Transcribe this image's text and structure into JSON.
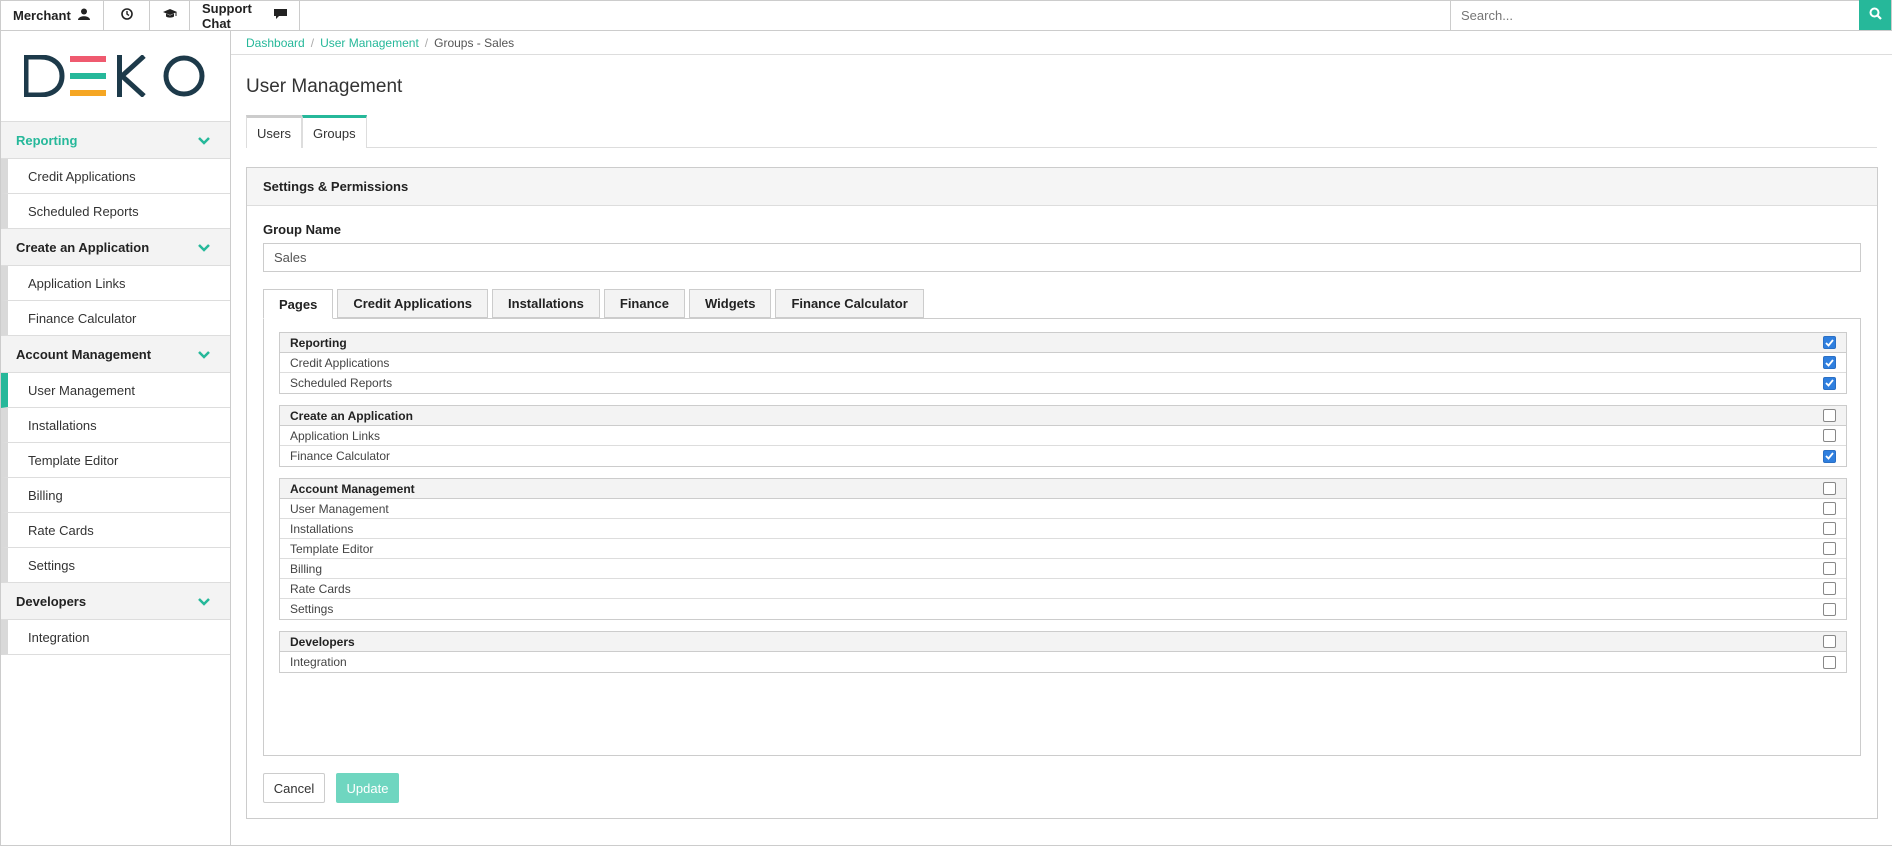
{
  "topbar": {
    "merchant_label": "Merchant",
    "support_label": "Support Chat",
    "search_placeholder": "Search...",
    "icons": [
      "user-icon",
      "clock-icon",
      "graduation-cap-icon",
      "chat-icon",
      "search-icon"
    ]
  },
  "logo": {
    "text": "DEKO"
  },
  "sidebar": {
    "sections": [
      {
        "label": "Reporting",
        "items": [
          "Credit Applications",
          "Scheduled Reports"
        ]
      },
      {
        "label": "Create an Application",
        "items": [
          "Application Links",
          "Finance Calculator"
        ]
      },
      {
        "label": "Account Management",
        "items": [
          "User Management",
          "Installations",
          "Template Editor",
          "Billing",
          "Rate Cards",
          "Settings"
        ]
      },
      {
        "label": "Developers",
        "items": [
          "Integration"
        ]
      }
    ]
  },
  "breadcrumb": {
    "dashboard": "Dashboard",
    "user_management": "User Management",
    "current": "Groups - Sales",
    "sep": "/"
  },
  "page_title": "User Management",
  "main_tabs": {
    "users": "Users",
    "groups": "Groups"
  },
  "panel": {
    "title": "Settings & Permissions",
    "group_name_label": "Group Name",
    "group_name_value": "Sales",
    "tabs": [
      "Pages",
      "Credit Applications",
      "Installations",
      "Finance",
      "Widgets",
      "Finance Calculator"
    ],
    "groups": [
      {
        "label": "Reporting",
        "checked": true,
        "items": [
          {
            "label": "Credit Applications",
            "checked": true
          },
          {
            "label": "Scheduled Reports",
            "checked": true
          }
        ]
      },
      {
        "label": "Create an Application",
        "checked": false,
        "items": [
          {
            "label": "Application Links",
            "checked": false
          },
          {
            "label": "Finance Calculator",
            "checked": true
          }
        ]
      },
      {
        "label": "Account Management",
        "checked": false,
        "items": [
          {
            "label": "User Management",
            "checked": false
          },
          {
            "label": "Installations",
            "checked": false
          },
          {
            "label": "Template Editor",
            "checked": false
          },
          {
            "label": "Billing",
            "checked": false
          },
          {
            "label": "Rate Cards",
            "checked": false
          },
          {
            "label": "Settings",
            "checked": false
          }
        ]
      },
      {
        "label": "Developers",
        "checked": false,
        "items": [
          {
            "label": "Integration",
            "checked": false
          }
        ]
      }
    ],
    "cancel_label": "Cancel",
    "update_label": "Update"
  },
  "colors": {
    "accent": "#26b89a",
    "checkbox": "#2f7fdf",
    "logo_red": "#ef5a6f",
    "logo_teal": "#26b89a",
    "logo_orange": "#f5a623",
    "logo_dark": "#1d3a4a"
  }
}
